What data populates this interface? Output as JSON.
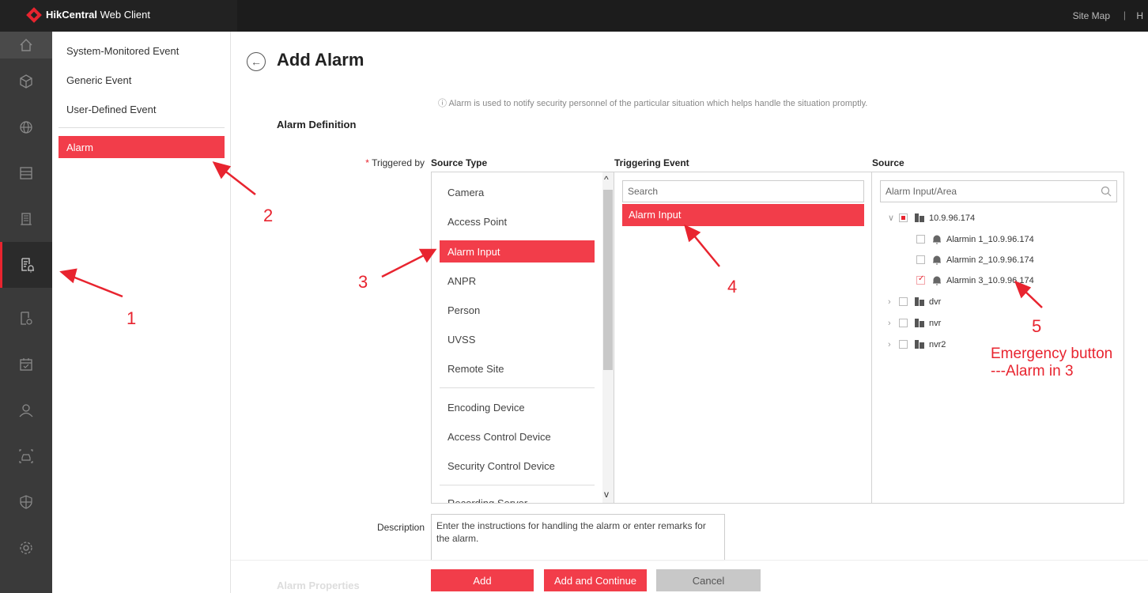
{
  "header": {
    "app_name_bold": "HikCentral",
    "app_name_rest": " Web Client",
    "site_map": "Site Map",
    "separator": "|",
    "overflow": "H"
  },
  "sidebar_icons": [
    "home-icon",
    "cube-icon",
    "globe-icon",
    "server-icon",
    "building-icon",
    "event-alarm-icon",
    "report-icon",
    "calendar-icon",
    "person-icon",
    "vehicle-icon",
    "shield-icon",
    "settings-icon"
  ],
  "subnav": {
    "items": [
      "System-Monitored Event",
      "Generic Event",
      "User-Defined Event"
    ],
    "active": "Alarm"
  },
  "page": {
    "title": "Add Alarm",
    "info": "Alarm is used to notify security personnel of the particular situation which helps handle the situation promptly.",
    "section": "Alarm Definition",
    "triggered_by_label": "Triggered by",
    "required_mark": "*"
  },
  "source_type": {
    "header": "Source Type",
    "items_top": [
      "Camera",
      "Access Point"
    ],
    "selected": "Alarm Input",
    "items_mid": [
      "ANPR",
      "Person",
      "UVSS",
      "Remote Site"
    ],
    "items_devices": [
      "Encoding Device",
      "Access Control Device",
      "Security Control Device"
    ],
    "items_cut": "Recording Server"
  },
  "triggering_event": {
    "header": "Triggering Event",
    "search_placeholder": "Search",
    "selected": "Alarm Input"
  },
  "source": {
    "header": "Source",
    "search_placeholder": "Alarm Input/Area",
    "tree": [
      {
        "label": "10.9.96.174",
        "state": "partial",
        "expanded": true
      },
      {
        "label": "Alarmin 1_10.9.96.174",
        "state": "unchecked"
      },
      {
        "label": "Alarmin 2_10.9.96.174",
        "state": "unchecked"
      },
      {
        "label": "Alarmin 3_10.9.96.174",
        "state": "checked"
      },
      {
        "label": "dvr",
        "state": "unchecked",
        "expanded": false
      },
      {
        "label": "nvr",
        "state": "unchecked",
        "expanded": false
      },
      {
        "label": "nvr2",
        "state": "unchecked",
        "expanded": false
      }
    ]
  },
  "description": {
    "label": "Description",
    "placeholder": "Enter the instructions for handling the alarm or enter remarks for the alarm."
  },
  "footer": {
    "properties_title": "Alarm Properties",
    "add": "Add",
    "add_continue": "Add and Continue",
    "cancel": "Cancel"
  },
  "annotations": {
    "n1": "1",
    "n2": "2",
    "n3": "3",
    "n4": "4",
    "n5": "5",
    "note_line1": "Emergency button",
    "note_line2": "---Alarm in 3",
    "color": "#e8242f"
  },
  "colors": {
    "accent": "#f23d4a",
    "topbar": "#1c1c1c",
    "sidebar": "#3a3a3a"
  }
}
